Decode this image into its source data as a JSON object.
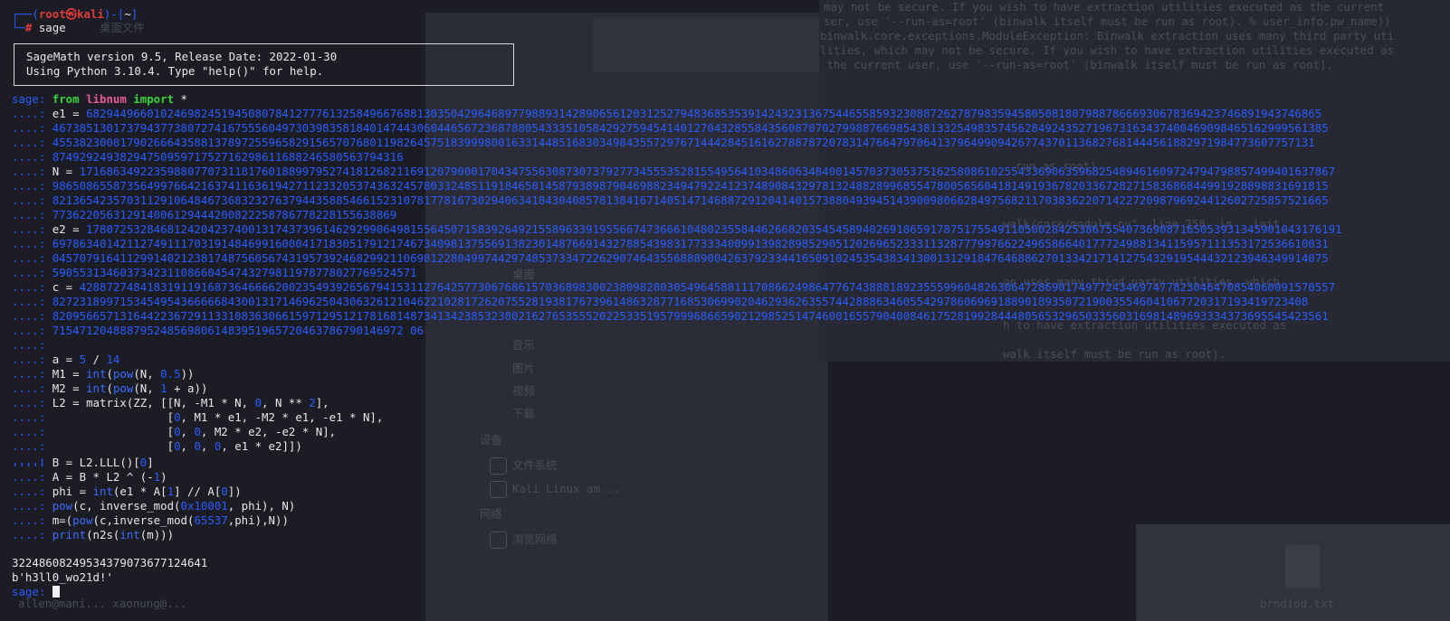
{
  "background": {
    "window_text_1": "may not be secure. If you wish to have extraction utilities executed as the current",
    "window_text_2": "ser, use '--run-as=root' (binwalk itself must be run as root). % user_info.pw_name))",
    "window_text_3": "binwalk.core.exceptions.ModuleException: Binwalk extraction uses many third party uti",
    "window_text_4": "lities, which may not be secure. If you wish to have extraction utilities executed as",
    "window_text_5": " the current user, use '--run-as=root' (binwalk itself must be run as root).",
    "window_text_6": "run as root).",
    "window_text_7": "walk/core/module.py\", line 258, in __init__",
    "window_text_8": "on uses many third party utilities, which",
    "window_text_9": "h to have extraction utilities executed as",
    "window_text_10": "walk itself must be run as root).",
    "sidebar_1": "桌面",
    "sidebar_2": "音乐",
    "sidebar_3": "图片",
    "sidebar_4": "视频",
    "sidebar_5": "下载",
    "sidebar_section_devices": "设备",
    "sidebar_6": "文件系统",
    "sidebar_7": "Kali Linux am...",
    "sidebar_section_network": "网络",
    "sidebar_8": "浏览网络",
    "file_label": "brndiod.txt",
    "taskbar_hint": "allen@mani... xaonung@..."
  },
  "terminal": {
    "prompt": {
      "corner_top": "┌──(",
      "user": "root㉿kali",
      "mid": ")-[",
      "path": "~",
      "end": "]",
      "corner_bottom": "└─",
      "hash": "# ",
      "command": "sage",
      "ghost": "     桌面文件"
    },
    "banner": {
      "line1": "SageMath version 9.5, Release Date: 2022-01-30",
      "line2": "Using Python 3.10.4. Type \"help()\" for help."
    },
    "sage_prompt": "sage: ",
    "cont_prompt": "....: ",
    "import_from": "from ",
    "import_module": "libnum",
    "import_rest": " import ",
    "import_star": "*",
    "e1_label": "e1 = ",
    "e1_lines": [
      "682944966010246982451945080784127776132584966768813035042964689779889314289065612031252794836853539142432313675446558593230887262787983594580508180798878666930678369423746891943746865",
      "467385130173794377380727416755560497303983581840147443060446567236878805433351058429275945414012704328558435608707027998876698543813325498357456284924352719673163437400469098465162999561385",
      "4553823008179026664358813789725596582915657076801198264575183999800163314485168303498435572976714442845161627887872078314766479706413796499094267743701136827681444561882971984773607757131",
      "8749292493829475095971752716298611688246580563794316"
    ],
    "n_label": "N = ",
    "n_lines": [
      "171686349223598807707311817601889979527418126821169120790001704347556308730737927734555352815549564103486063484001457037305375162580861025543369063596825489461609724794798857499401637867",
      "986508655873564997664216374116361942711233205374363245780332485119184650145879389879046988234947922412374890843297813248828996855478005656041814919367820336728271583686844991928898831691815",
      "821365423570311291064846736832327637944358854661523107817781673029406341843040857813841671405147146887291204140157388049394514390098066284975682117038362207142272098796924412602725857521665",
      "773622056312914006129444200822258786778228155638869"
    ],
    "e2_label": "e2 = ",
    "e2_lines": [
      "178072532846812420423740013174373961462929906498155645071583926492155896339195566747366610480235584462668203545458940269186591787517554911050028425386755407369087165053931345901043176191",
      "697863401421127491117031914846991600041718305179121746734098137556913823014876691432788543983177333400991398289852905120269652333113287779976622496586640177724988134115957111353172536610031",
      "045707916411299140212381748756056743195739246829921106981228049974429748537334722629074643556888900426379233441650910245354383413001312918476468862701334217141275432919544432123946349914075",
      "590553134603734231108660454743279811978778027769524571"
    ],
    "c_label": "c = ",
    "c_lines": [
      "428872748418319119168736466662002354939265679415311276425773067686157036898300238098280305496458811170866249864776743888189235559960482630647286901749772434697477823046470854060091570557",
      "827231899715345495436666684300131714696250430632612104622102817262075528193817673961486328771685306990204629362635574428886346055429786069691889018935072190035546041067720317193419723408",
      "820956657131644223672911331083630661597129512178168148734134238532380216276535552022533519579996866590212985251474600165579040084617528199284448056532965033560316981489693334373695545423561",
      "7154712048887952485698061483951965720463786790146972 06"
    ],
    "a_line_a": "a = ",
    "a_num1": "5",
    "a_op": " / ",
    "a_num2": "14",
    "m1_a": "M1 = ",
    "m1_int": "int",
    "m1_b": "(",
    "m1_pow": "pow",
    "m1_c": "(N, ",
    "m1_num": "0.5",
    "m1_d": "))",
    "m2_a": "M2 = ",
    "m2_int": "int",
    "m2_b": "(",
    "m2_pow": "pow",
    "m2_c": "(N, ",
    "m2_num": "1",
    "m2_d": " + a))",
    "l2_line1_a": "L2 = matrix(ZZ, [[N, -M1 * N, ",
    "l2_line1_zero": "0",
    "l2_line1_b": ", N ** ",
    "l2_line1_two": "2",
    "l2_line1_c": "],",
    "l2_pad": "                 ",
    "l2_line2_a": "[",
    "l2_line2_zero": "0",
    "l2_line2_b": ", M1 * e1, -M2 * e1, -e1 * N],",
    "l2_line3_a": "[",
    "l2_line3_zero1": "0",
    "l2_line3_sep": ", ",
    "l2_line3_zero2": "0",
    "l2_line3_b": ", M2 * e2, -e2 * N],",
    "l2_line4_a": "[",
    "l2_line4_z1": "0",
    "l2_line4_z2": "0",
    "l2_line4_z3": "0",
    "l2_line4_b": ", e1 * e2]])",
    "b_line_a": "B = L2.LLL()[",
    "b_line_zero": "0",
    "b_line_b": "]",
    "a2_line_a": "A = B * L2 ^ (-",
    "a2_line_one": "1",
    "a2_line_b": ")",
    "phi_a": "phi = ",
    "phi_int": "int",
    "phi_b": "(e1 * A[",
    "phi_one": "1",
    "phi_c": "] // A[",
    "phi_zero": "0",
    "phi_d": "])",
    "pow_fn": "pow",
    "pow_a": "(c, inverse_mod(",
    "pow_hex": "0x10001",
    "pow_b": ", phi), N)",
    "m_a": "m=(",
    "m_pow": "pow",
    "m_b": "(c,inverse_mod(",
    "m_num": "65537",
    "m_c": ",phi),N))",
    "print_fn": "print",
    "print_a": "(n2s(",
    "print_int": "int",
    "print_b": "(m)))",
    "output_number": "32248608249534379073677124641",
    "output_bytes": "b'h3ll0_wo21d!'"
  }
}
